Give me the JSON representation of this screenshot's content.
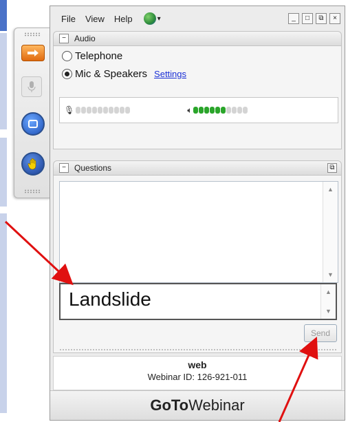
{
  "menu": {
    "file": "File",
    "view": "View",
    "help": "Help",
    "globe_icon": "globe-icon",
    "window_controls": [
      "_",
      "□",
      "⧉",
      "×"
    ]
  },
  "audio": {
    "header": "Audio",
    "option_telephone": "Telephone",
    "option_mic_speakers": "Mic & Speakers",
    "selected": "Mic & Speakers",
    "settings_link": "Settings",
    "mic_level_active": 0,
    "speaker_level_active": 6,
    "meter_segments": 10
  },
  "questions": {
    "header": "Questions",
    "input_value": "Landslide",
    "send_label": "Send"
  },
  "session": {
    "name": "web",
    "webinar_id": "Webinar ID: 126-921-011"
  },
  "brand": {
    "prefix": "GoTo",
    "suffix": "Webinar"
  },
  "colors": {
    "accent_orange": "#e06a10",
    "link_blue": "#1a2fd6",
    "meter_green": "#2aa52a",
    "arrow_red": "#e01010"
  }
}
